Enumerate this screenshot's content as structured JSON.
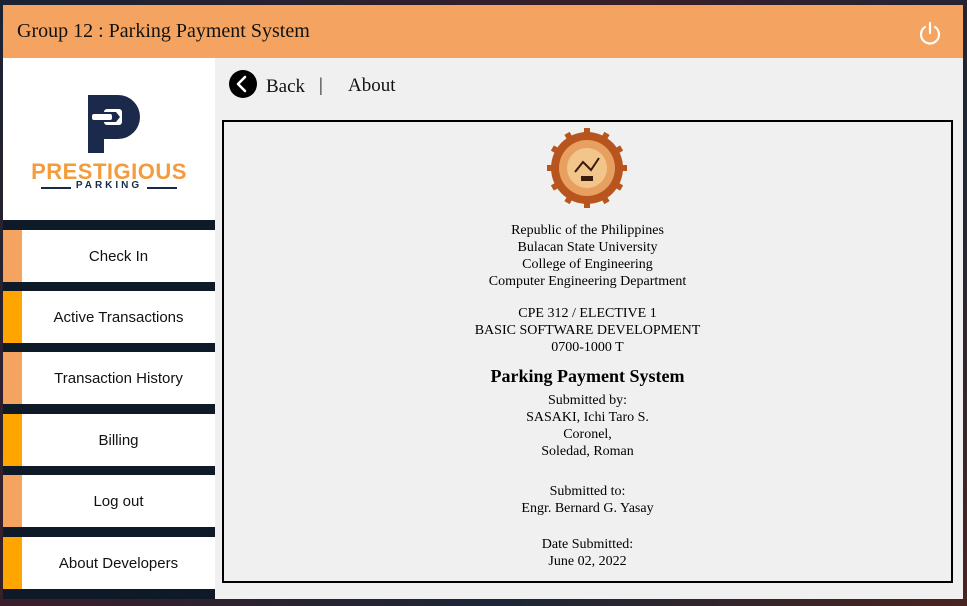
{
  "app": {
    "title": "Group 12 : Parking Payment System"
  },
  "colors": {
    "titlebar": "#f4a460",
    "accent_light": "#f4a460",
    "accent_dark": "#ffa500",
    "sidebar": "#0f1a28"
  },
  "logo": {
    "name": "PRESTIGIOUS",
    "sub": "PARKING"
  },
  "sidebar": {
    "items": [
      {
        "label": "Check In",
        "accent": "#f4a460"
      },
      {
        "label": "Active Transactions",
        "accent": "#ffa500"
      },
      {
        "label": "Transaction History",
        "accent": "#f4a460"
      },
      {
        "label": "Billing",
        "accent": "#ffa500"
      },
      {
        "label": "Log out",
        "accent": "#f4a460"
      },
      {
        "label": "About Developers",
        "accent": "#ffa500"
      }
    ]
  },
  "nav": {
    "back_label": "Back",
    "separator": "|",
    "current": "About"
  },
  "icons": {
    "power": "power-icon",
    "back": "chevron-left-icon",
    "seal": "university-seal"
  },
  "about": {
    "institution": [
      "Republic of the Philippines",
      "Bulacan State University",
      "College of Engineering",
      "Computer Engineering Department"
    ],
    "course": [
      "CPE 312 / ELECTIVE 1",
      "BASIC SOFTWARE DEVELOPMENT",
      "0700-1000 T"
    ],
    "project_title": "Parking Payment System",
    "submitted_by_label": "Submitted by:",
    "submitted_by": [
      "SASAKI, Ichi Taro S.",
      "Coronel,",
      "Soledad, Roman"
    ],
    "submitted_to_label": "Submitted to:",
    "submitted_to": "Engr. Bernard G. Yasay",
    "date_label": "Date Submitted:",
    "date": "June 02, 2022"
  }
}
